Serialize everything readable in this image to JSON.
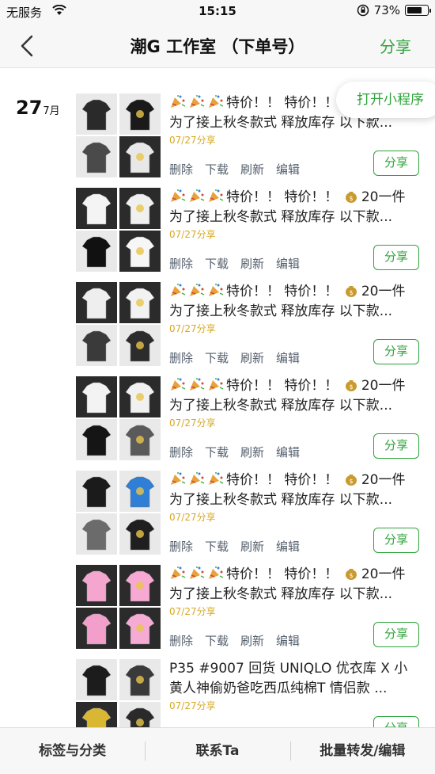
{
  "status_bar": {
    "carrier": "无服务",
    "time": "15:15",
    "battery": "73%",
    "battery_level": 0.73
  },
  "nav": {
    "title": "潮G 工作室 （下单号）",
    "share": "分享"
  },
  "date": {
    "day": "27",
    "month": "7月"
  },
  "mini_program": "打开小程序",
  "post_actions": {
    "delete": "删除",
    "download": "下载",
    "refresh": "刷新",
    "edit": "编辑",
    "share": "分享"
  },
  "posts": [
    {
      "line1": "特价！！ 特价！！",
      "line2": "为了接上秋冬款式 释放库存 以下款...",
      "date": "07/27分享",
      "thumbs": [
        "#2a2a2a",
        "#1a1a1a",
        "#4a4a4a",
        "#e8e8e8"
      ]
    },
    {
      "line1": "特价！！ 特价！！ 💰20一件",
      "line2": "为了接上秋冬款式 释放库存 以下款...",
      "date": "07/27分享",
      "thumbs": [
        "#f4f4f4",
        "#f0f0f0",
        "#111111",
        "#f6f6f6"
      ]
    },
    {
      "line1": "特价！！ 特价！！ 💰20一件",
      "line2": "为了接上秋冬款式 释放库存 以下款...",
      "date": "07/27分享",
      "thumbs": [
        "#eeeeee",
        "#f2f2f2",
        "#3a3a3a",
        "#2c2c2c"
      ]
    },
    {
      "line1": "特价！！ 特价！！ 💰20一件",
      "line2": "为了接上秋冬款式 释放库存 以下款...",
      "date": "07/27分享",
      "thumbs": [
        "#f3f3f3",
        "#f1f1f1",
        "#151515",
        "#5a5a5a"
      ]
    },
    {
      "line1": "特价！！ 特价！！ 💰20一件",
      "line2": "为了接上秋冬款式 释放库存 以下款...",
      "date": "07/27分享",
      "thumbs": [
        "#1b1b1b",
        "#2f7fd6",
        "#6b6b6b",
        "#1f1f1f"
      ]
    },
    {
      "line1": "特价！！ 特价！！ 💰20一件",
      "line2": "为了接上秋冬款式 释放库存 以下款...",
      "date": "07/27分享",
      "thumbs": [
        "#f4a6cf",
        "#f7a8d3",
        "#f39fcb",
        "#f6abd5"
      ]
    },
    {
      "line1": "P35 #9007 回货 UNIQLO 优衣库 X 小",
      "line2": "黄人神偷奶爸吃西瓜纯棉T 情侣款 ...",
      "date": "07/27分享",
      "thumbs": [
        "#1c1c1c",
        "#3a3a3a",
        "#d9b733",
        "#2a2a2a"
      ]
    }
  ],
  "bottom_bar": {
    "tags": "标签与分类",
    "contact": "联系Ta",
    "batch": "批量转发/编辑"
  },
  "colors": {
    "accent_green": "#2ea33a",
    "date_gold": "#d7a924",
    "action_gray": "#55606e"
  }
}
